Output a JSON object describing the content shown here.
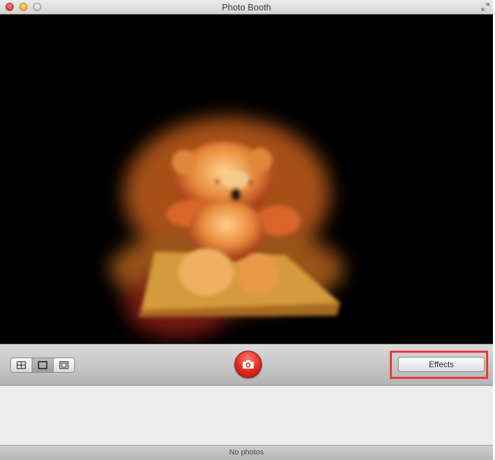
{
  "window": {
    "title": "Photo Booth"
  },
  "toolbar": {
    "view_modes": [
      {
        "name": "four-up-view",
        "icon": "grid-2x2-icon"
      },
      {
        "name": "single-photo-view",
        "icon": "single-frame-icon",
        "selected": true
      },
      {
        "name": "video-view",
        "icon": "film-strip-icon"
      }
    ],
    "shutter_icon": "camera-icon",
    "effects_label": "Effects"
  },
  "status": {
    "text": "No photos"
  },
  "colors": {
    "highlight": "#e53935",
    "shutter": "#e02a22"
  }
}
